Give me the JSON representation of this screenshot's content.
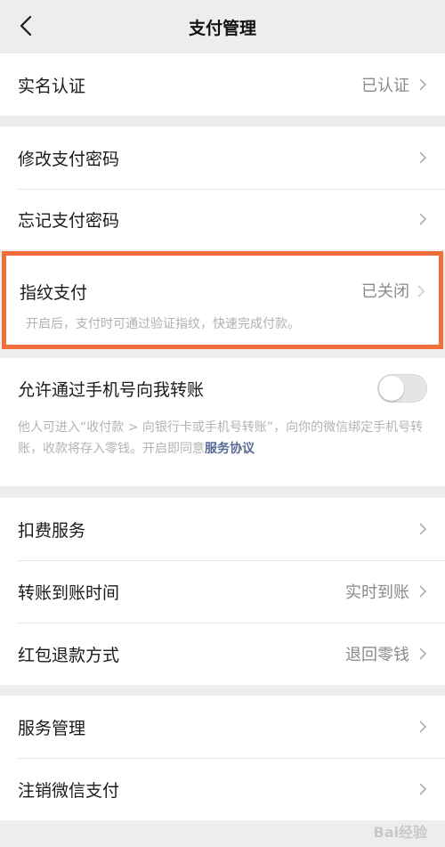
{
  "header": {
    "title": "支付管理"
  },
  "section1": {
    "items": [
      {
        "label": "实名认证",
        "value": "已认证"
      }
    ]
  },
  "section2": {
    "items": [
      {
        "label": "修改支付密码"
      },
      {
        "label": "忘记支付密码"
      }
    ]
  },
  "fingerprint": {
    "label": "指纹支付",
    "value": "已关闭",
    "description": "开启后，支付时可通过验证指纹，快速完成付款。",
    "highlight_color": "#f16d3a"
  },
  "phone_transfer": {
    "label": "允许通过手机号向我转账",
    "enabled": false,
    "description": "他人可进入“收付款 > 向银行卡或手机号转账”，向你的微信绑定手机号转账，收款将存入零钱。开启即同意",
    "link": "服务协议"
  },
  "section4": {
    "items": [
      {
        "label": "扣费服务"
      },
      {
        "label": "转账到账时间",
        "value": "实时到账"
      },
      {
        "label": "红包退款方式",
        "value": "退回零钱"
      }
    ]
  },
  "section5": {
    "items": [
      {
        "label": "服务管理"
      },
      {
        "label": "注销微信支付"
      }
    ]
  },
  "colors": {
    "background": "#ededed",
    "link": "#576b95"
  },
  "watermark": {
    "text": "Bai经验"
  }
}
